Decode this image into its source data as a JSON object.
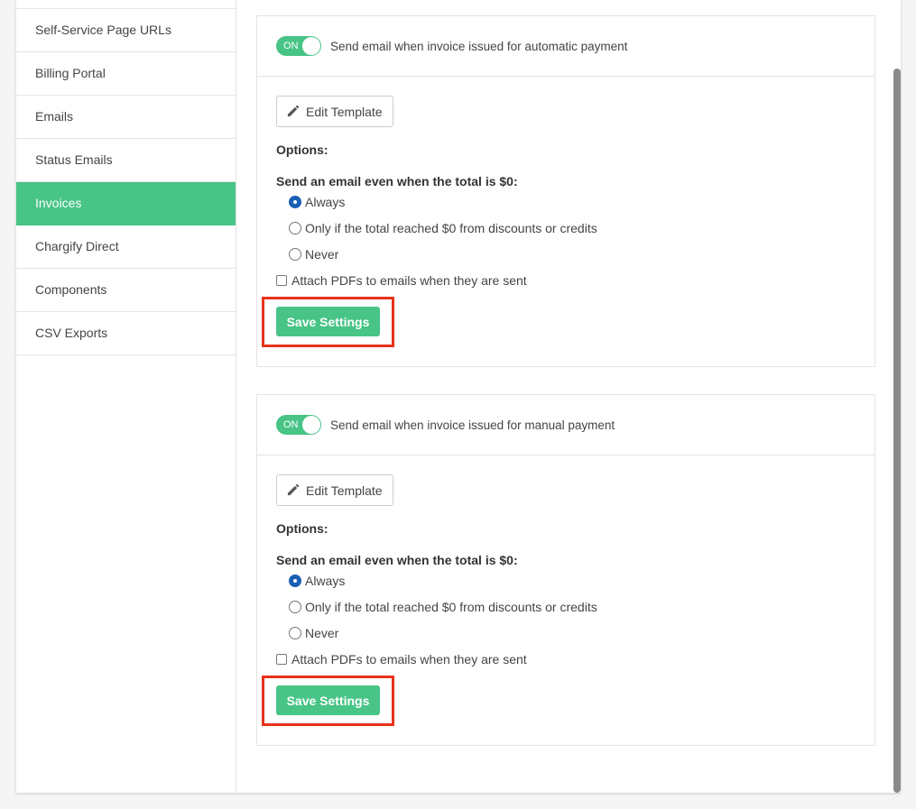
{
  "sidebar": {
    "items": [
      {
        "label": "Self-Service Page URLs",
        "active": false
      },
      {
        "label": "Billing Portal",
        "active": false
      },
      {
        "label": "Emails",
        "active": false
      },
      {
        "label": "Status Emails",
        "active": false
      },
      {
        "label": "Invoices",
        "active": true
      },
      {
        "label": "Chargify Direct",
        "active": false
      },
      {
        "label": "Components",
        "active": false
      },
      {
        "label": "CSV Exports",
        "active": false
      }
    ]
  },
  "panels": [
    {
      "toggle_label": "ON",
      "title": "Send email when invoice issued for automatic payment",
      "edit_template_label": "Edit Template",
      "options_label": "Options:",
      "zero_total_label": "Send an email even when the total is $0:",
      "radios": [
        {
          "label": "Always",
          "checked": true
        },
        {
          "label": "Only if the total reached $0 from discounts or credits",
          "checked": false
        },
        {
          "label": "Never",
          "checked": false
        }
      ],
      "attach_label": "Attach PDFs to emails when they are sent",
      "save_label": "Save Settings"
    },
    {
      "toggle_label": "ON",
      "title": "Send email when invoice issued for manual payment",
      "edit_template_label": "Edit Template",
      "options_label": "Options:",
      "zero_total_label": "Send an email even when the total is $0:",
      "radios": [
        {
          "label": "Always",
          "checked": true
        },
        {
          "label": "Only if the total reached $0 from discounts or credits",
          "checked": false
        },
        {
          "label": "Never",
          "checked": false
        }
      ],
      "attach_label": "Attach PDFs to emails when they are sent",
      "save_label": "Save Settings"
    }
  ],
  "colors": {
    "accent": "#48c486",
    "highlight": "#e8311a",
    "radio_checked": "#1a5fb4"
  }
}
